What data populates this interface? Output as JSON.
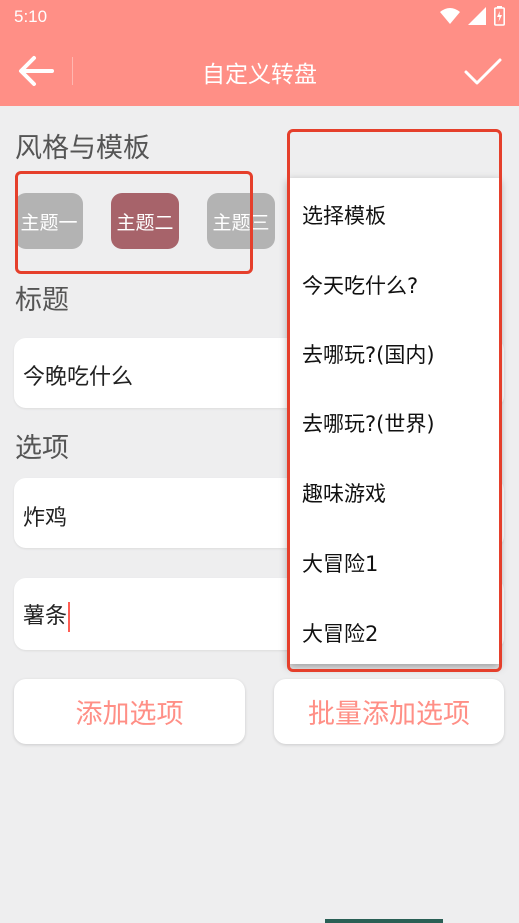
{
  "status": {
    "time": "5:10"
  },
  "appbar": {
    "title": "自定义转盘"
  },
  "style_section": {
    "title": "风格与模板"
  },
  "themes": [
    {
      "label": "主题一",
      "color": "#b3b3b3"
    },
    {
      "label": "主题二",
      "color": "#a7636a"
    },
    {
      "label": "主题三",
      "color": "#b3b3b3"
    }
  ],
  "title_section": {
    "title": "标题",
    "value": "今晚吃什么"
  },
  "options_section": {
    "title": "选项",
    "items": [
      "炸鸡",
      "薯条"
    ]
  },
  "actions": {
    "add_option": "添加选项",
    "batch_add": "批量添加选项"
  },
  "dropdown": {
    "items": [
      "选择模板",
      "今天吃什么?",
      "去哪玩?(国内)",
      "去哪玩?(世界)",
      "趣味游戏",
      "大冒险1",
      "大冒险2"
    ]
  },
  "colors": {
    "accent": "#ff8f86",
    "highlight": "#e53f2b"
  }
}
